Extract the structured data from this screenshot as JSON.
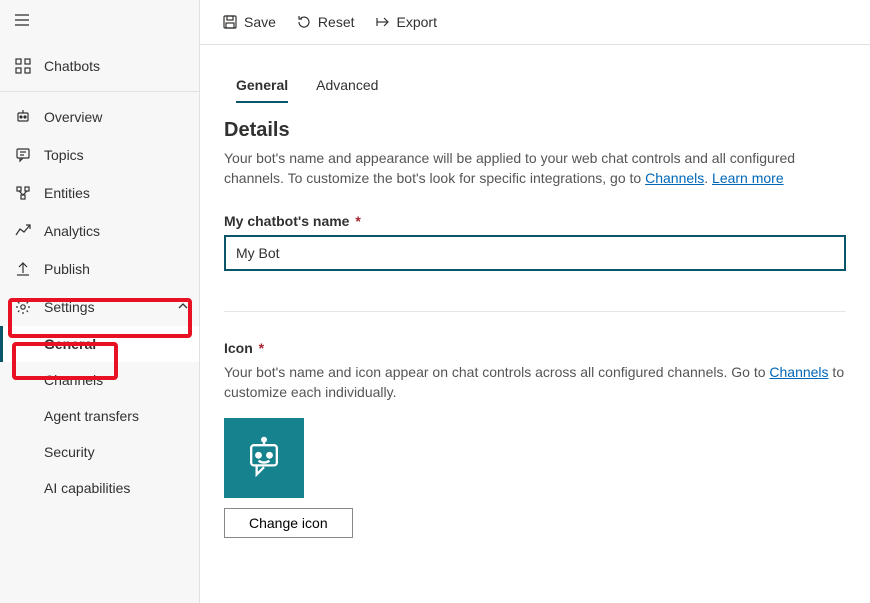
{
  "topbar": {
    "save": "Save",
    "reset": "Reset",
    "export": "Export"
  },
  "sidebar": {
    "chatbots": "Chatbots",
    "overview": "Overview",
    "topics": "Topics",
    "entities": "Entities",
    "analytics": "Analytics",
    "publish": "Publish",
    "settings": "Settings",
    "sub": {
      "general": "General",
      "channels": "Channels",
      "agent_transfers": "Agent transfers",
      "security": "Security",
      "ai": "AI capabilities"
    }
  },
  "tabs": {
    "general": "General",
    "advanced": "Advanced"
  },
  "details": {
    "title": "Details",
    "desc_prefix": "Your bot's name and appearance will be applied to your web chat controls and all configured channels. To customize the bot's look for specific integrations, go to ",
    "channels_link": "Channels",
    "desc_sep": ". ",
    "learn_more": "Learn more",
    "name_label": "My chatbot's name",
    "name_value": "My Bot"
  },
  "icon": {
    "label": "Icon",
    "desc_prefix": "Your bot's name and icon appear on chat controls across all configured channels. Go to ",
    "channels_link": "Channels",
    "desc_suffix": " to customize each individually.",
    "change_btn": "Change icon"
  }
}
